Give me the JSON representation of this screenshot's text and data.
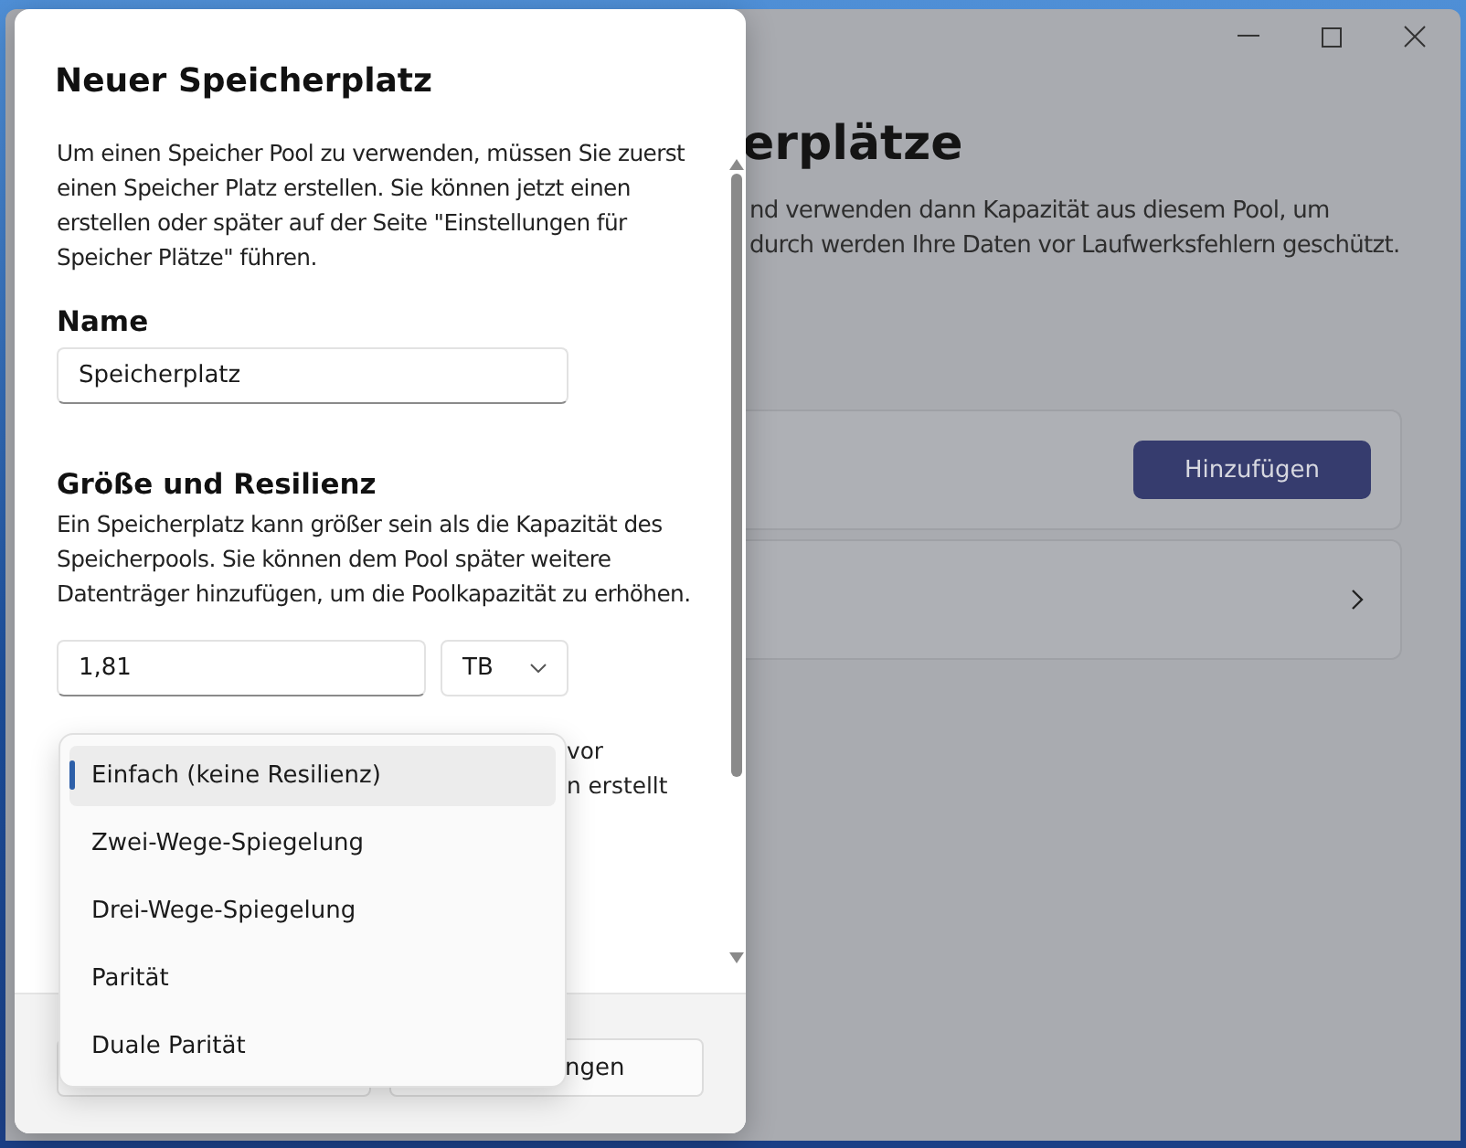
{
  "background_window": {
    "heading": "erplätze",
    "description_lines": [
      "nd verwenden dann Kapazität aus diesem Pool, um",
      "durch werden Ihre Daten vor Laufwerksfehlern geschützt."
    ],
    "add_button": "Hinzufügen"
  },
  "dialog": {
    "title": "Neuer Speicherplatz",
    "intro": "Um einen Speicher Pool zu verwenden, müssen Sie zuerst einen Speicher Platz erstellen. Sie können jetzt einen erstellen oder später auf der Seite \"Einstellungen für Speicher Plätze\" führen.",
    "name_label": "Name",
    "name_value": "Speicherplatz",
    "size_heading": "Größe und Resilienz",
    "size_text": "Ein Speicherplatz kann größer sein als die Kapazität des Speicherpools. Sie können dem Pool später weitere Datenträger hinzufügen, um die Poolkapazität zu erhöhen.",
    "size_value": "1,81",
    "unit": "TB",
    "partial_text_lines": [
      "vor",
      "n erstellt"
    ],
    "footer_button": "ngen"
  },
  "dropdown": {
    "options": [
      {
        "label": "Einfach (keine Resilienz)",
        "selected": true
      },
      {
        "label": "Zwei-Wege-Spiegelung",
        "selected": false
      },
      {
        "label": "Drei-Wege-Spiegelung",
        "selected": false
      },
      {
        "label": "Parität",
        "selected": false
      },
      {
        "label": "Duale Parität",
        "selected": false
      }
    ]
  }
}
